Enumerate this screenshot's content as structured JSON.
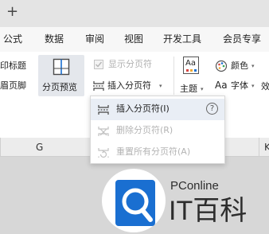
{
  "titlebar": {
    "new_tab_label": "+"
  },
  "menubar": {
    "items": [
      "公式",
      "数据",
      "审阅",
      "视图",
      "开发工具",
      "会员专享"
    ]
  },
  "ribbon": {
    "print_titles_label": "印标题",
    "header_footer_label": "眉页脚",
    "page_break_preview_label": "分页预览",
    "show_page_break_label": "显示分页符",
    "insert_page_break_label": "插入分页符",
    "theme_label": "主题",
    "colors_label": "颜色",
    "font_label": "字体",
    "effects_label": "效",
    "font_prefix": "Aa",
    "theme_icon_text": "Aa",
    "dropdown_caret": "▾"
  },
  "colhead": {
    "column_label": "G",
    "column_label_partial": "K"
  },
  "dropdown": {
    "items": [
      {
        "label": "插入分页符(I)",
        "enabled": true
      },
      {
        "label": "删除分页符(R)",
        "enabled": false
      },
      {
        "label": "重置所有分页符(A)",
        "enabled": false
      }
    ],
    "help_symbol": "?"
  },
  "watermark": {
    "brand": "PConline",
    "logo_text": "IT百科"
  },
  "colors": {
    "accent_blue": "#1a6fd1",
    "highlight": "#e9eef5",
    "disabled_text": "#b4b4b4"
  }
}
